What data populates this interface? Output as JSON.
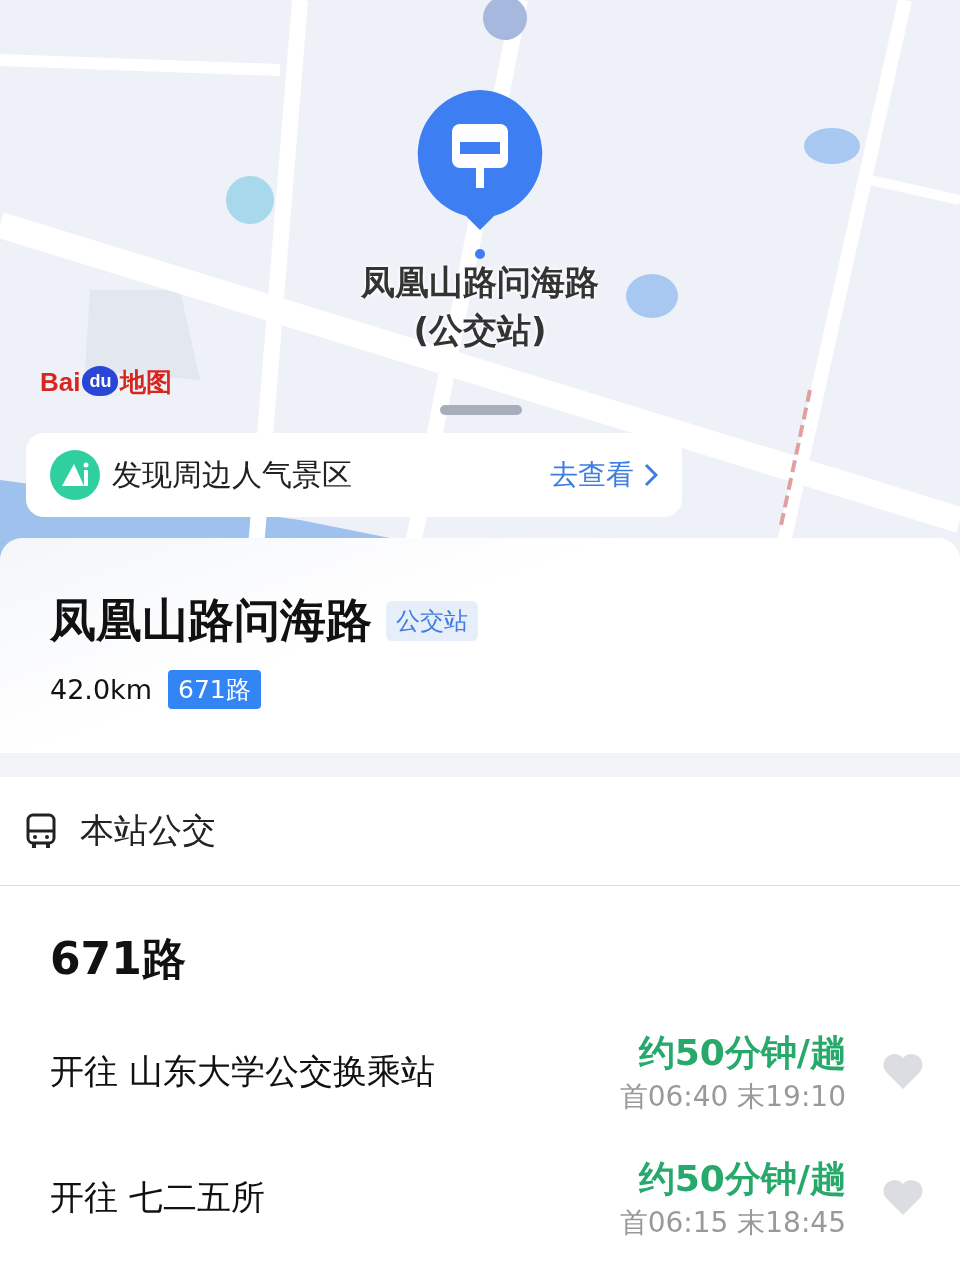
{
  "map": {
    "logo": {
      "word": "Bai",
      "paw": "du",
      "suffix": "地图"
    },
    "marker": {
      "label": "凤凰山路问海路(公交站)"
    },
    "discover": {
      "text": "发现周边人气景区",
      "link": "去查看"
    }
  },
  "stop": {
    "name": "凤凰山路问海路",
    "type_tag": "公交站",
    "distance": "42.0km",
    "routes": [
      "671路"
    ]
  },
  "section": {
    "title": "本站公交"
  },
  "route": {
    "name": "671路",
    "directions": [
      {
        "destination": "开往 山东大学公交换乘站",
        "frequency": "约50分钟/趟",
        "hours": "首06:40 末19:10",
        "favorited": false
      },
      {
        "destination": "开往 七二五所",
        "frequency": "约50分钟/趟",
        "hours": "首06:15 末18:45",
        "favorited": false
      }
    ]
  }
}
